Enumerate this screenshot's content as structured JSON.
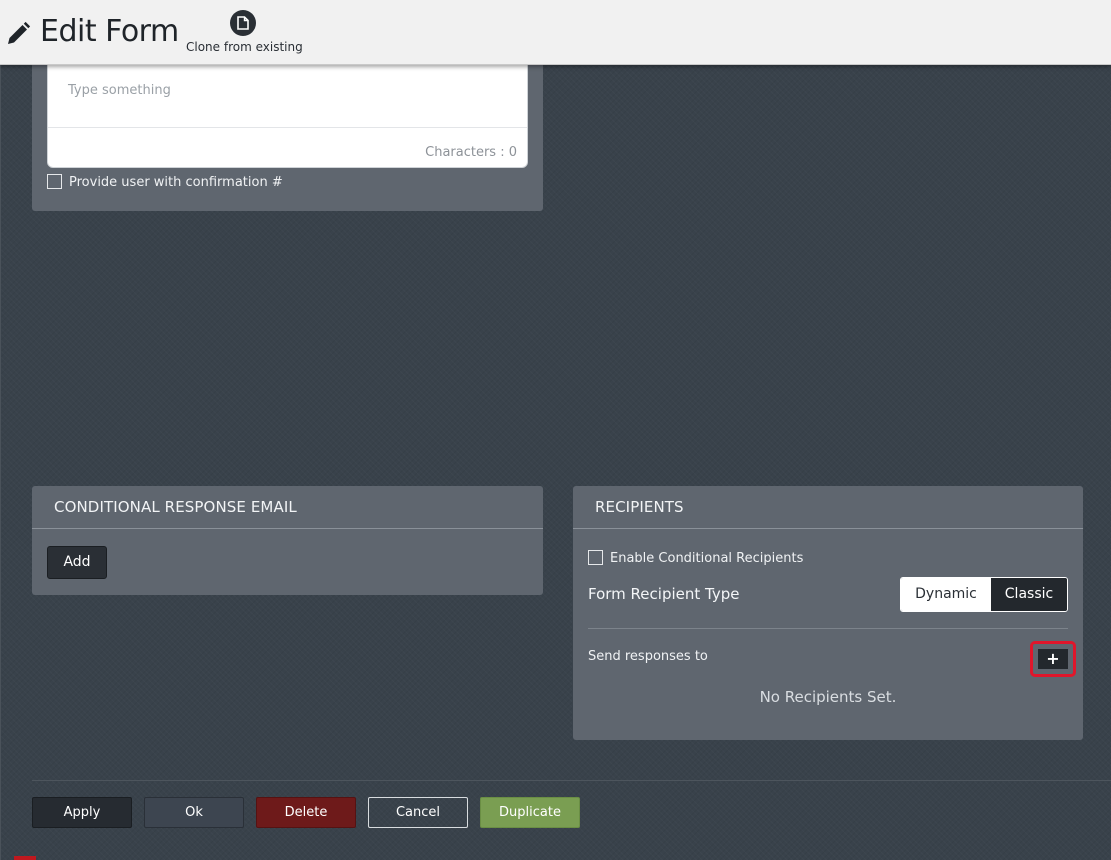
{
  "header": {
    "title": "Edit Form",
    "clone_label": "Clone from existing",
    "icons": {
      "title": "pencil-icon",
      "clone": "document-icon"
    }
  },
  "confirmation_card": {
    "textarea_placeholder": "Type something",
    "char_count_text": "Characters : 0",
    "confirmation_checkbox_label": "Provide user with confirmation #",
    "confirmation_checked": false
  },
  "conditional_email_card": {
    "header": "CONDITIONAL RESPONSE EMAIL",
    "add_label": "Add"
  },
  "recipients_card": {
    "header": "RECIPIENTS",
    "enable_conditional_label": "Enable Conditional Recipients",
    "enable_conditional_checked": false,
    "recipient_type_label": "Form Recipient Type",
    "type_options": [
      "Dynamic",
      "Classic"
    ],
    "selected_type": "Classic",
    "send_responses_label": "Send responses to",
    "add_recipient_label": "+",
    "empty_text": "No Recipients Set."
  },
  "footer": {
    "apply": "Apply",
    "ok": "Ok",
    "delete": "Delete",
    "cancel": "Cancel",
    "duplicate": "Duplicate"
  },
  "colors": {
    "background": "#39424b",
    "card": "#5f666f",
    "header_bar": "#f1f1f1",
    "highlight": "#e0162b",
    "delete": "#6e1a1a",
    "duplicate": "#7a9e52"
  }
}
